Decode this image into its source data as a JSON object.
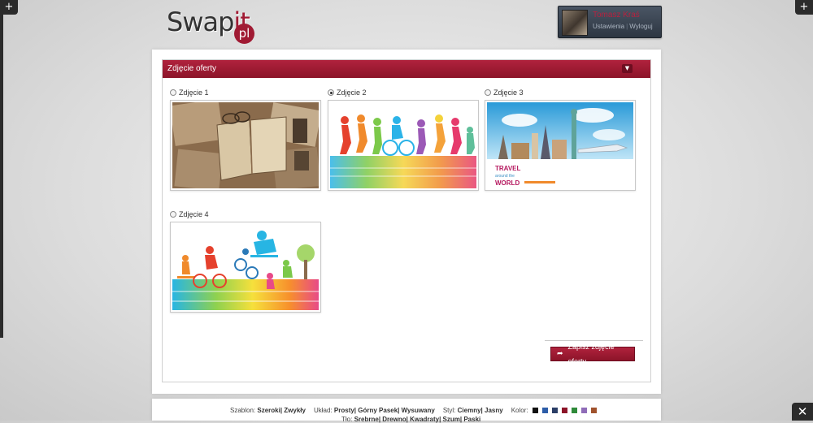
{
  "corners": {
    "left_label": "+",
    "right_label": "+",
    "tools_label": "✕"
  },
  "logo": {
    "main": "Swap",
    "accent": "it",
    "badge": "pl"
  },
  "user": {
    "name": "Tomasz Kraś",
    "settings_link": "Ustawienia",
    "logout_link": "Wyloguj",
    "separator": "|"
  },
  "panel": {
    "title": "Zdjęcie oferty",
    "toggle_icon": "▼",
    "photos": [
      {
        "label": "Zdjęcie 1",
        "selected": false,
        "image": "vintage-book-collage"
      },
      {
        "label": "Zdjęcie 2",
        "selected": true,
        "image": "colorful-sports-silhouettes"
      },
      {
        "label": "Zdjęcie 3",
        "selected": false,
        "image": "travel-world-landmarks",
        "image_text_1": "TRAVEL",
        "image_text_2": "around the",
        "image_text_3": "WORLD"
      },
      {
        "label": "Zdjęcie 4",
        "selected": false,
        "image": "rainbow-extreme-sports"
      }
    ],
    "save_button": "Zapisz zdjęcie oferty",
    "save_icon": "➦"
  },
  "footer": {
    "szablon_label": "Szablon:",
    "szablon_options": "Szeroki| Zwykły",
    "uklad_label": "Układ:",
    "uklad_options": "Prosty| Górny Pasek| Wysuwany",
    "styl_label": "Styl:",
    "styl_options": "Ciemny| Jasny",
    "kolor_label": "Kolor:",
    "colors": [
      "#111111",
      "#2d5da8",
      "#2b3e66",
      "#8c1429",
      "#2f8a3a",
      "#8f6cb8",
      "#a0522d"
    ],
    "tlo_label": "Tło:",
    "tlo_options": "Srebrne| Drewno| Kwadraty| Szum| Paski"
  },
  "accent_color": "#a01a33"
}
